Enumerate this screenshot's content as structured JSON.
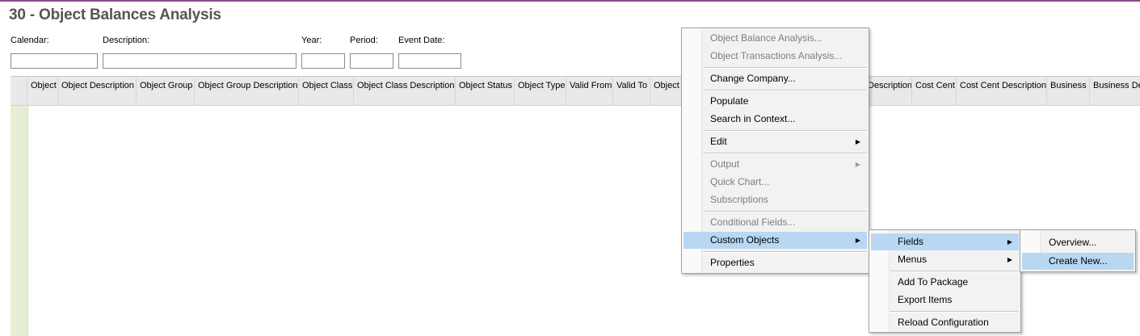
{
  "page": {
    "title": "30 -  Object Balances Analysis"
  },
  "filters": {
    "calendar_label": "Calendar:",
    "description_label": "Description:",
    "year_label": "Year:",
    "period_label": "Period:",
    "event_date_label": "Event Date:",
    "calendar_value": "",
    "description_value": "",
    "year_value": "",
    "period_value": "",
    "event_date_value": ""
  },
  "grid": {
    "columns": [
      "Object",
      "Object Description",
      "Object Group",
      "Object Group Description",
      "Object Class",
      "Object Class Description",
      "Object Status",
      "Object Type",
      "Valid From",
      "Valid To",
      "Object",
      "Description",
      "Cost Cent",
      "Cost Cent Description",
      "Business",
      "Business De"
    ]
  },
  "context_menu": {
    "items": [
      {
        "label": "Object Balance Analysis...",
        "disabled": true
      },
      {
        "label": "Object Transactions Analysis...",
        "disabled": true
      },
      {
        "label": "Change Company...",
        "disabled": false
      },
      {
        "label": "Populate",
        "disabled": false
      },
      {
        "label": "Search in Context...",
        "disabled": false
      },
      {
        "label": "Edit",
        "disabled": false,
        "submenu": true
      },
      {
        "label": "Output",
        "disabled": true,
        "submenu": true
      },
      {
        "label": "Quick Chart...",
        "disabled": true
      },
      {
        "label": "Subscriptions",
        "disabled": true
      },
      {
        "label": "Conditional Fields...",
        "disabled": true
      },
      {
        "label": "Custom Objects",
        "disabled": false,
        "submenu": true,
        "highlighted": true
      },
      {
        "label": "Properties",
        "disabled": false
      }
    ]
  },
  "custom_objects_menu": {
    "items": [
      {
        "label": "Fields",
        "submenu": true,
        "highlighted": true
      },
      {
        "label": "Menus",
        "submenu": true
      },
      {
        "label": "Add To Package"
      },
      {
        "label": "Export Items"
      },
      {
        "label": "Reload Configuration"
      }
    ]
  },
  "fields_menu": {
    "items": [
      {
        "label": "Overview..."
      },
      {
        "label": "Create New...",
        "highlighted": true
      }
    ]
  },
  "icons": {
    "submenu_arrow": "▶"
  }
}
